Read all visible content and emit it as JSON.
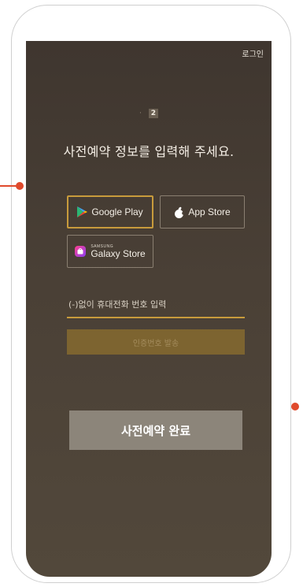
{
  "header": {
    "login_label": "로그인"
  },
  "steps": {
    "previous": "·",
    "current": "2"
  },
  "heading": "사전예약 정보를 입력해 주세요.",
  "stores": {
    "google": {
      "label": "Google Play",
      "icon": "google-play-icon"
    },
    "apple": {
      "label": "App Store",
      "icon": "apple-icon"
    },
    "galaxy": {
      "brand": "SAMSUNG",
      "label": "Galaxy Store",
      "icon": "galaxy-store-icon"
    }
  },
  "phone_input": {
    "placeholder": "(-)없이 휴대전화 번호 입력",
    "value": ""
  },
  "verify_button_label": "인증번호 발송",
  "complete_button_label": "사전예약 완료",
  "colors": {
    "accent": "#c89b3c",
    "background": "#4a4036",
    "marker": "#e04a2c"
  }
}
